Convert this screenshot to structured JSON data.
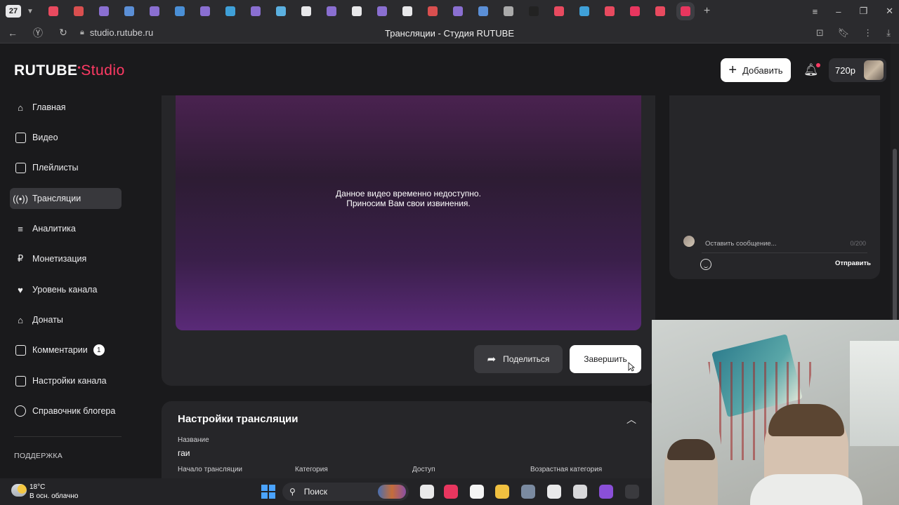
{
  "browser": {
    "tab_count": "27",
    "url": "studio.rutube.ru",
    "page_title": "Трансляции - Студия RUTUBE",
    "tab_colors": [
      "#e84a5f",
      "#d94f4f",
      "#8a6fd1",
      "#5b8fd6",
      "#8a6fd1",
      "#4a8fd6",
      "#8a6fd1",
      "#3fa0d8",
      "#8a6fd1",
      "#5bb0e0",
      "#e8e8ea",
      "#8a6fd1",
      "#e8e8ea",
      "#8a6fd1",
      "#e8e8ea",
      "#d94f4f",
      "#8a6fd1",
      "#5b8fd6",
      "#aaaaaa",
      "#222222",
      "#e84a5f",
      "#3fa0d8",
      "#e84a5f",
      "#e8365f",
      "#e84a5f",
      "#e8365f"
    ]
  },
  "header": {
    "logo_main": "RUTUBE",
    "logo_sub": "Studio",
    "add_label": "Добавить",
    "quality_label": "720p"
  },
  "sidebar": {
    "items": [
      {
        "label": "Главная",
        "icon": "home-icon"
      },
      {
        "label": "Видео",
        "icon": "video-icon"
      },
      {
        "label": "Плейлисты",
        "icon": "playlist-icon"
      },
      {
        "label": "Трансляции",
        "icon": "broadcast-icon"
      },
      {
        "label": "Аналитика",
        "icon": "analytics-icon"
      },
      {
        "label": "Монетизация",
        "icon": "ruble-icon"
      },
      {
        "label": "Уровень канала",
        "icon": "level-icon"
      },
      {
        "label": "Донаты",
        "icon": "donate-icon"
      },
      {
        "label": "Комментарии",
        "icon": "comments-icon",
        "badge": "1"
      },
      {
        "label": "Настройки канала",
        "icon": "settings-icon"
      },
      {
        "label": "Справочник блогера",
        "icon": "help-icon"
      }
    ],
    "support_label": "ПОДДЕРЖКА"
  },
  "player": {
    "message_line1": "Данное видео временно недоступно.",
    "message_line2": "Приносим Вам свои извинения.",
    "share_label": "Поделиться",
    "finish_label": "Завершить"
  },
  "settings": {
    "title": "Настройки трансляции",
    "name_label": "Название",
    "name_value": "гаи",
    "start_label": "Начало трансляции",
    "category_label": "Категория",
    "access_label": "Доступ",
    "age_label": "Возрастная категория"
  },
  "chat": {
    "placeholder": "Оставить сообщение...",
    "counter": "0/200",
    "send_label": "Отправить"
  },
  "taskbar": {
    "temperature": "18°C",
    "weather": "В осн. облачно",
    "search_label": "Поиск"
  },
  "colors": {
    "accent": "#ff3a64",
    "background": "#1a1a1c",
    "card": "#262629"
  }
}
